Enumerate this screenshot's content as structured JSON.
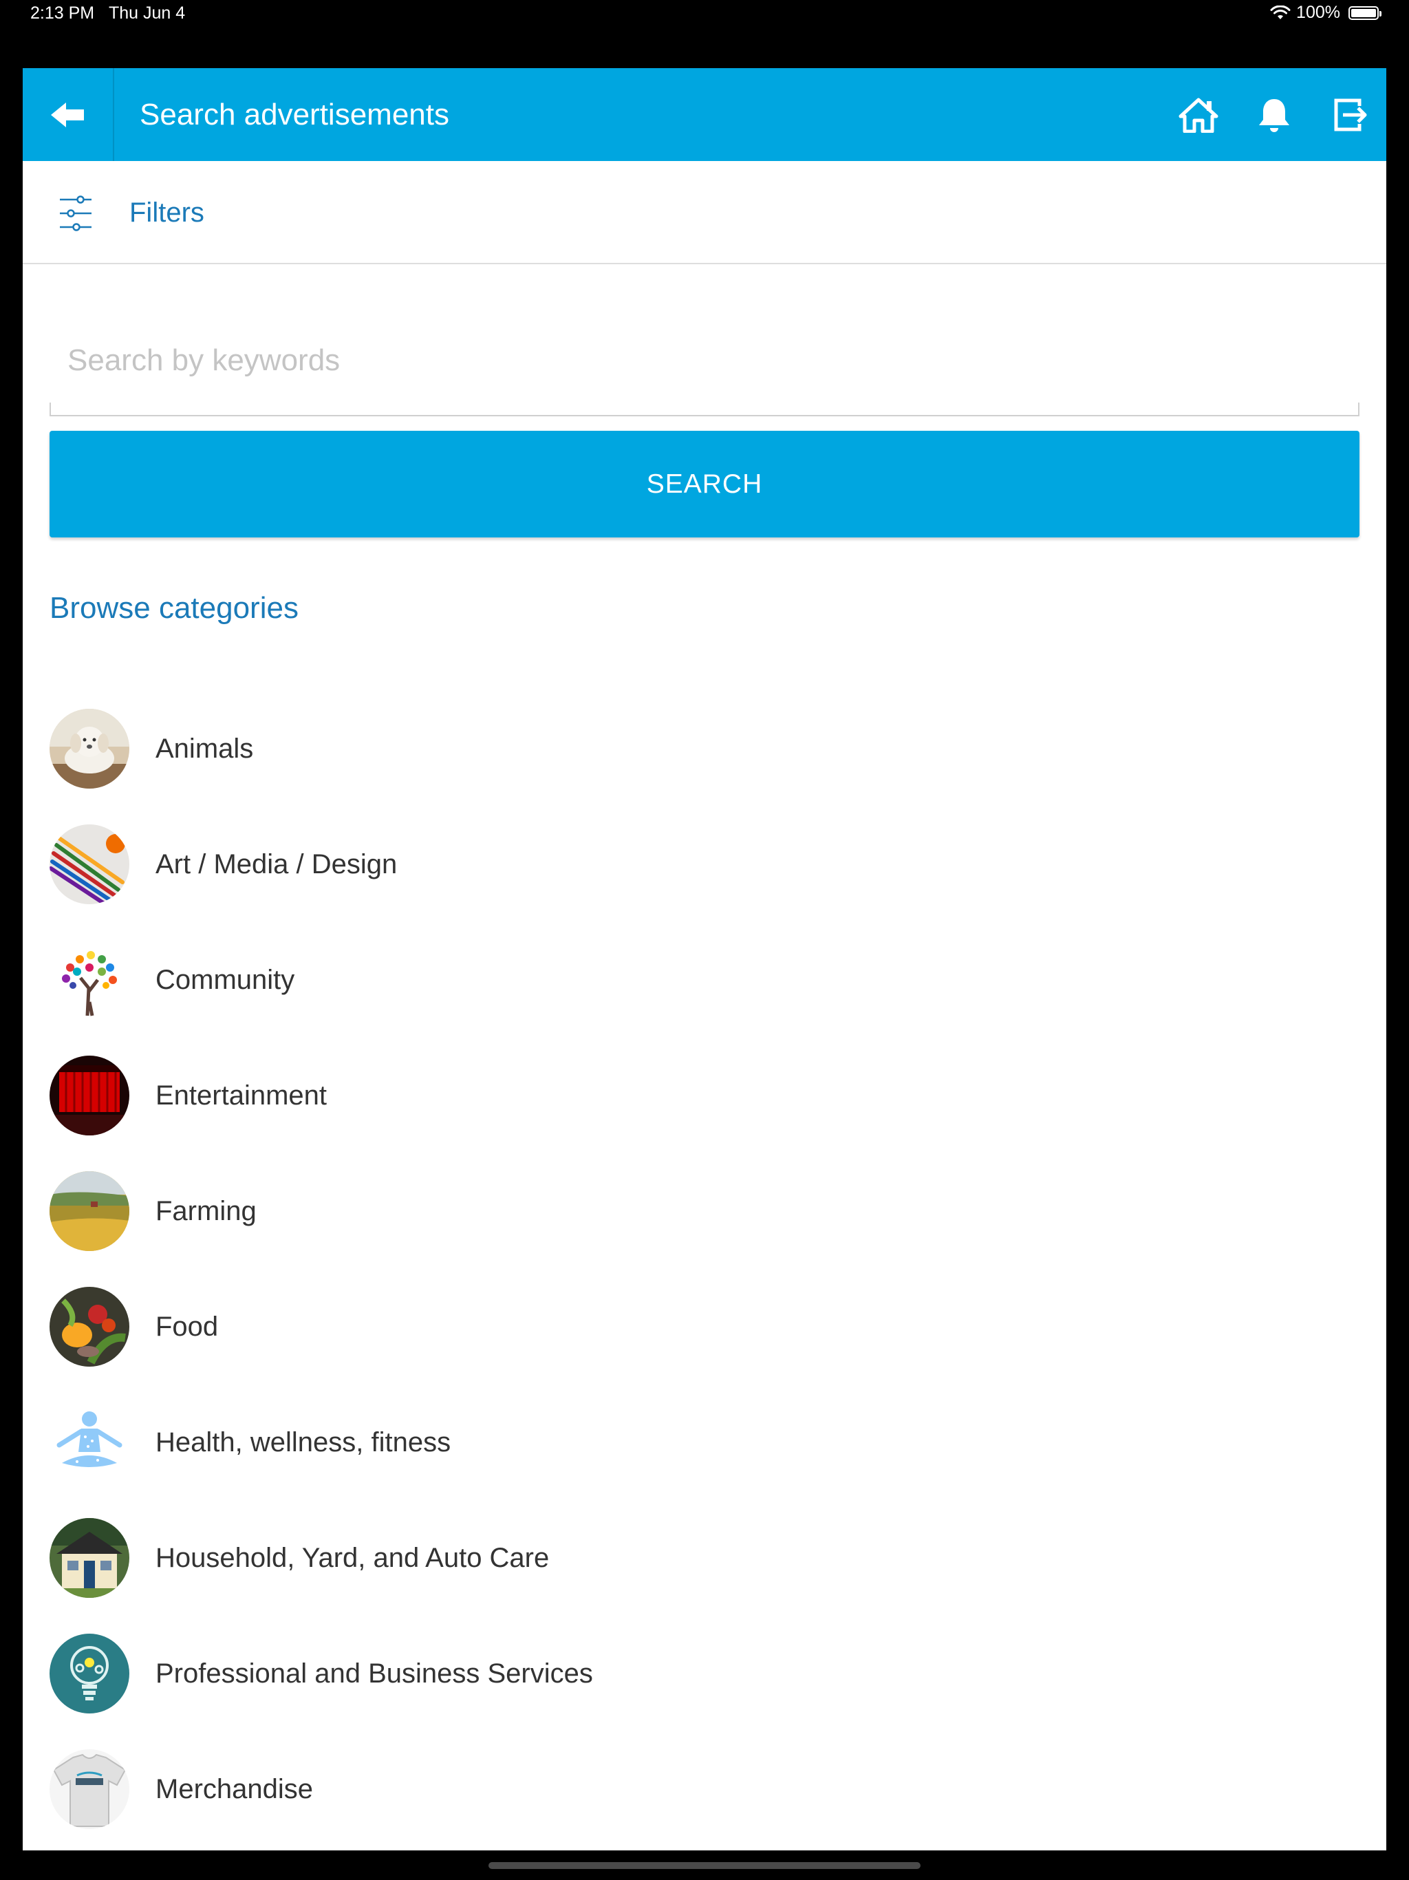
{
  "status_bar": {
    "time": "2:13 PM",
    "date": "Thu Jun 4",
    "battery": "100%",
    "battery_level": 1.0
  },
  "header": {
    "title": "Search advertisements",
    "icons": [
      "back-arrow-icon",
      "home-icon",
      "bell-icon",
      "logout-icon"
    ]
  },
  "filters": {
    "label": "Filters",
    "icon": "sliders-icon"
  },
  "search": {
    "placeholder": "Search by keywords",
    "value": "",
    "button_label": "SEARCH"
  },
  "browse": {
    "title": "Browse categories"
  },
  "categories": [
    {
      "label": "Animals",
      "icon": "puppy-photo"
    },
    {
      "label": "Art / Media / Design",
      "icon": "colored-pencils-photo"
    },
    {
      "label": "Community",
      "icon": "colorful-tree-photo"
    },
    {
      "label": "Entertainment",
      "icon": "red-curtain-theater-photo"
    },
    {
      "label": "Farming",
      "icon": "farm-field-photo"
    },
    {
      "label": "Food",
      "icon": "vegetables-photo"
    },
    {
      "label": "Health, wellness, fitness",
      "icon": "meditation-figure-photo"
    },
    {
      "label": "Household, Yard, and Auto Care",
      "icon": "house-photo"
    },
    {
      "label": "Professional and Business Services",
      "icon": "lightbulb-gears-photo"
    },
    {
      "label": "Merchandise",
      "icon": "t-shirt-photo"
    }
  ],
  "colors": {
    "primary": "#00a6e0",
    "link": "#1b7ab8",
    "text": "#333333"
  }
}
